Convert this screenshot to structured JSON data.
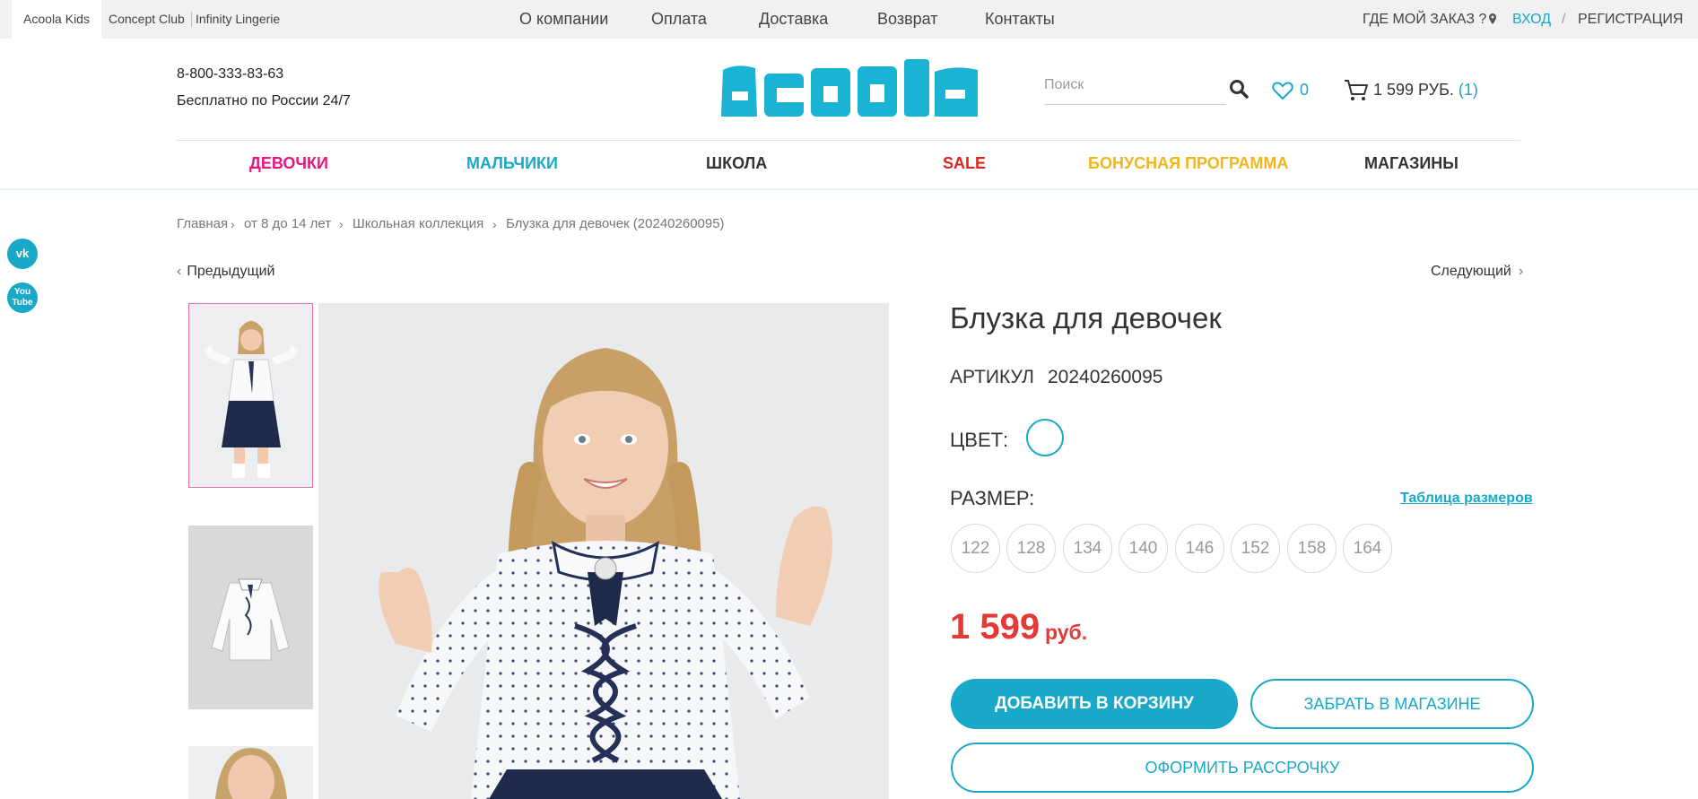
{
  "topbar": {
    "brands": [
      "Acoola Kids",
      "Concept Club",
      "Infinity Lingerie"
    ],
    "menu": [
      "О компании",
      "Оплата",
      "Доставка",
      "Возврат",
      "Контакты"
    ],
    "order_status": "ГДЕ МОЙ ЗАКАЗ ?",
    "login": "ВХОД",
    "separator": "/",
    "register": "РЕГИСТРАЦИЯ"
  },
  "header": {
    "phone": "8-800-333-83-63",
    "phone_note": "Бесплатно по России 24/7",
    "logo_text": "acoola",
    "search_placeholder": "Поиск",
    "favorites_count": "0",
    "cart_total": "1 599 РУБ.",
    "cart_count": "(1)"
  },
  "nav": [
    {
      "label": "ДЕВОЧКИ",
      "color": "#e5177f"
    },
    {
      "label": "МАЛЬЧИКИ",
      "color": "#1aa8c8"
    },
    {
      "label": "ШКОЛА",
      "color": "#333333"
    },
    {
      "label": "SALE",
      "color": "#e0231c"
    },
    {
      "label": "БОНУСНАЯ ПРОГРАММА",
      "color": "#f2b61c"
    },
    {
      "label": "МАГАЗИНЫ",
      "color": "#333333"
    }
  ],
  "social": [
    "vk-icon",
    "youtube-icon"
  ],
  "breadcrumb": [
    "Главная",
    "от 8 до 14 лет",
    "Школьная коллекция",
    "Блузка для девочек (20240260095)"
  ],
  "pager": {
    "prev": "Предыдущий",
    "next": "Следующий"
  },
  "product": {
    "title": "Блузка для девочек",
    "article_label": "АРТИКУЛ",
    "article_value": "20240260095",
    "color_label": "ЦВЕТ:",
    "size_label": "РАЗМЕР:",
    "size_table_link": "Таблица размеров",
    "sizes": [
      "122",
      "128",
      "134",
      "140",
      "146",
      "152",
      "158",
      "164"
    ],
    "price": "1 599",
    "currency": "руб.",
    "add_to_cart": "ДОБАВИТЬ В КОРЗИНУ",
    "pickup": "ЗАБРАТЬ В МАГАЗИНЕ",
    "installment": "ОФОРМИТЬ РАССРОЧКУ"
  },
  "colors": {
    "accent": "#1aa8c8",
    "price": "#e53935",
    "thumb_active_border": "#e46fa7"
  }
}
